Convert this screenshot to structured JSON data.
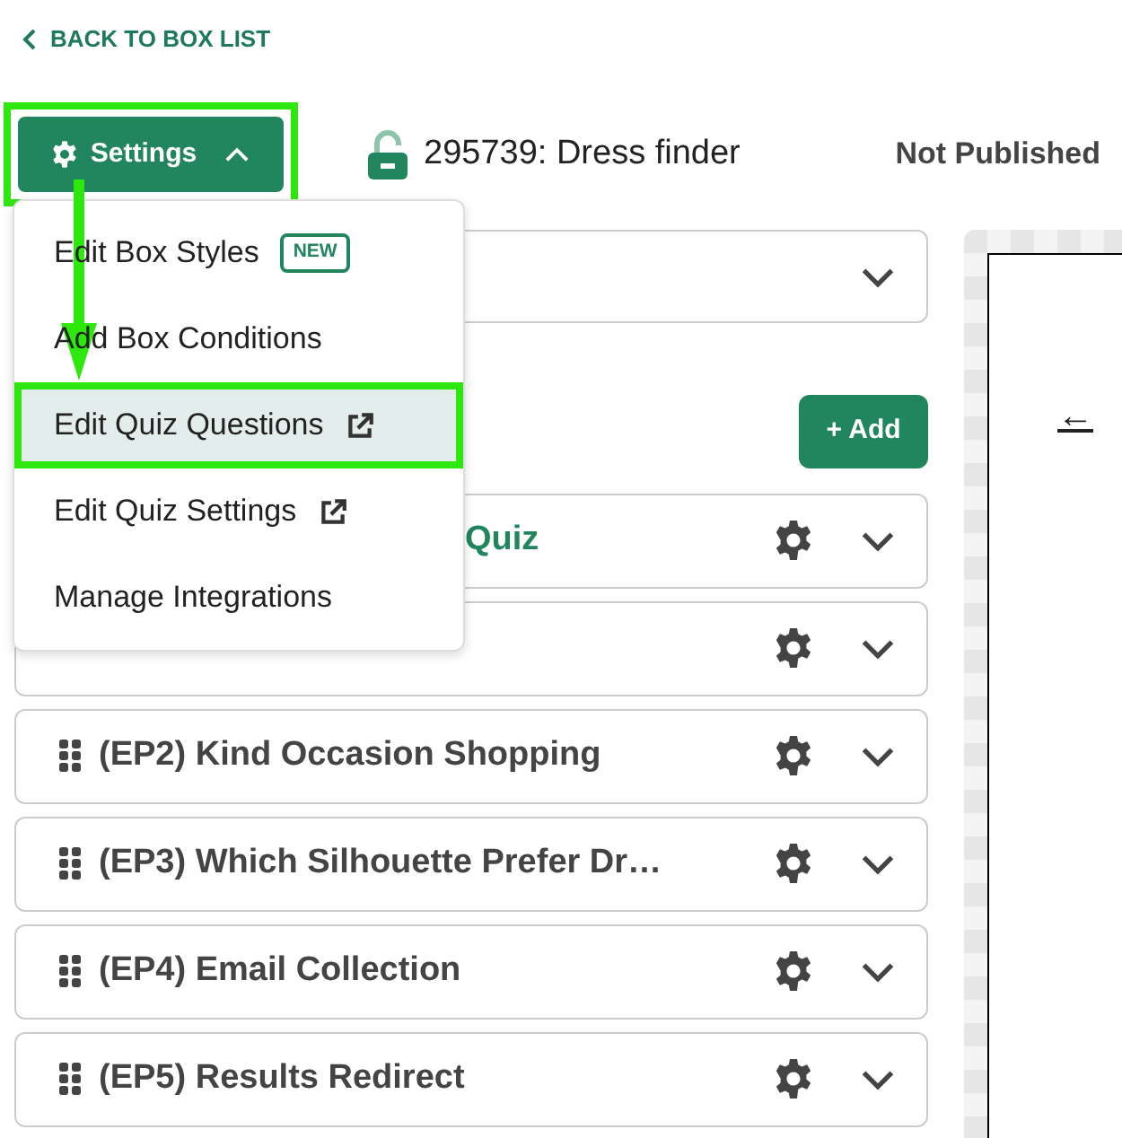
{
  "back_link": {
    "label": "BACK TO BOX LIST"
  },
  "settings_button": {
    "label": "Settings",
    "expanded": true,
    "highlighted": true
  },
  "box": {
    "title": "295739: Dress finder",
    "locked": false,
    "status": "Not Published"
  },
  "settings_menu": {
    "items": [
      {
        "label": "Edit Box Styles",
        "badge": "NEW",
        "external": false,
        "selected": false,
        "highlighted": false
      },
      {
        "label": "Add Box Conditions",
        "external": false,
        "selected": false,
        "highlighted": false
      },
      {
        "label": "Edit Quiz Questions",
        "external": true,
        "selected": true,
        "highlighted": true
      },
      {
        "label": "Edit Quiz Settings",
        "external": true,
        "selected": false,
        "highlighted": false
      },
      {
        "label": "Manage Integrations",
        "external": false,
        "selected": false,
        "highlighted": false
      }
    ]
  },
  "add_button": {
    "label": "+ Add"
  },
  "steps": [
    {
      "kind": "start",
      "title": "Quiz",
      "covered": true
    },
    {
      "kind": "step",
      "covered": true
    },
    {
      "kind": "step",
      "title": "(EP2) Kind Occasion Shopping",
      "covered": false
    },
    {
      "kind": "step",
      "title": "(EP3) Which Silhouette Prefer Dr…",
      "covered": false
    },
    {
      "kind": "step",
      "title": "(EP4) Email Collection",
      "covered": false
    },
    {
      "kind": "step",
      "title": "(EP5) Results Redirect",
      "covered": false
    }
  ],
  "preview": {
    "link": "←"
  }
}
